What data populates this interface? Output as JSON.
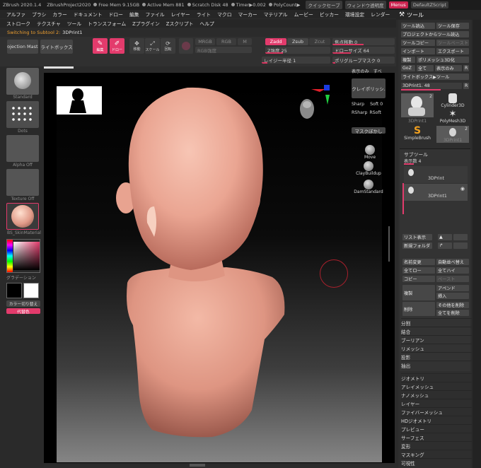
{
  "titlebar": {
    "items": [
      "ZBrush 2020.1.4",
      "ZBrushProject2020",
      "Free Mem 9.15GB",
      "Active Mem 881",
      "Scratch Disk 48",
      "Timer▶0.002",
      "PolyCount▶"
    ],
    "quicksave": "クイックセーブ",
    "window_transparency": "ウィンドウ透明度",
    "menus_btn": "Menus",
    "script_btn": "DefaultZScript"
  },
  "menu_row1": [
    "アルファ",
    "ブラシ",
    "カラー",
    "ドキュメント",
    "ドロー",
    "編集",
    "ファイル",
    "レイヤー",
    "ライト",
    "マクロ",
    "マーカー",
    "マテリアル",
    "ムービー",
    "ピッカー",
    "環境設定",
    "レンダー",
    "ステンシル"
  ],
  "menu_row2": [
    "ストローク",
    "テクスチャ",
    "ツール",
    "トランスフォーム",
    "Zプラグイン",
    "Zスクリプト",
    "ヘルプ"
  ],
  "tool_header": "ツール",
  "status": {
    "switching": "Switching to Subtool 2:",
    "current": "3DPrint1"
  },
  "shelf": {
    "projection_master": "Projection Master",
    "lightbox": "ライトボックス",
    "edit": "編集",
    "draw": "ドロー",
    "move": "移動",
    "scale": "スケール",
    "rotate": "回転",
    "mrgb": "MRGB",
    "rgb": "RGB",
    "m": "M",
    "rgb_intensity": "RGB強度",
    "zadd": "Zadd",
    "zsub": "Zsub",
    "zcut": "Zcut",
    "z_intensity": "Z強度 25",
    "focal_shift": "焦点移動 0",
    "draw_size": "ドローサイズ 64",
    "polygroup_mask": "ポリグループマスク 0",
    "lazy_radius": "レイジー半径 1"
  },
  "left_tray": {
    "brush": "Standard",
    "stroke": "Dots",
    "alpha": "Alpha Off",
    "texture": "Texture Off",
    "material": "BS_SkinMaterial",
    "gradation": "グラデーション",
    "color_switch": "カラー切り替え",
    "alternate": "代替色"
  },
  "canvas_side": {
    "show_only": "表示のみ",
    "all": "すべ",
    "clay_polish": "クレイポリッシ.",
    "sharp": "Sharp",
    "soft": "Soft 0",
    "rsharp": "RSharp",
    "rsoft": "RSoft",
    "mask_blur": "マスクぼかし",
    "brushes": [
      "Move",
      "ClayBuildup",
      "DamStandard"
    ]
  },
  "tool_panel": {
    "load": "ツール読込",
    "save": "ツール保存",
    "load_project": "プロジェクトからツール読込",
    "copy": "ツールコピー",
    "paste": "ツールペースト",
    "import": "インポート",
    "export": "エクスポート",
    "clone": "複製",
    "make_polymesh": "ポリメッシュ3D化",
    "goz": "GoZ",
    "all": "全て",
    "visible": "表示のみ",
    "r": "R",
    "lightbox_tool": "ライトボックス▶ツール",
    "current_tool": "3DPrint1. 48",
    "tools": [
      {
        "name": "3DPrint1",
        "count": "2"
      },
      {
        "name": "Cylinder3D",
        "count": ""
      },
      {
        "name": "PolyMesh3D",
        "count": ""
      },
      {
        "name": "SimpleBrush",
        "count": ""
      },
      {
        "name": "3DPrint1",
        "count": "2"
      }
    ],
    "subtool": {
      "title": "サブツール",
      "visible_count": "表示数 4",
      "items": [
        "3DPrint",
        "3DPrint1"
      ],
      "list_all": "リスト表示",
      "new_folder": "新規フォルダ",
      "rename": "名前変更",
      "auto_reorder": "自動並べ替え",
      "all_low": "全てロー",
      "all_high": "全てハイ",
      "copy": "コピー",
      "paste": "ペースト",
      "duplicate": "複製",
      "append": "アペンド",
      "insert": "挿入",
      "delete": "削除",
      "delete_other": "その他を削除",
      "delete_all": "全てを削除"
    },
    "sub_menus": [
      "分割",
      "結合",
      "ブーリアン",
      "リメッシュ",
      "投影",
      "抽出"
    ],
    "menus": [
      "ジオメトリ",
      "アレイメッシュ",
      "ナノメッシュ",
      "レイヤー",
      "ファイバーメッシュ",
      "HDジオメトリ",
      "プレビュー",
      "サーフェス",
      "変形",
      "マスキング",
      "可視性"
    ]
  }
}
